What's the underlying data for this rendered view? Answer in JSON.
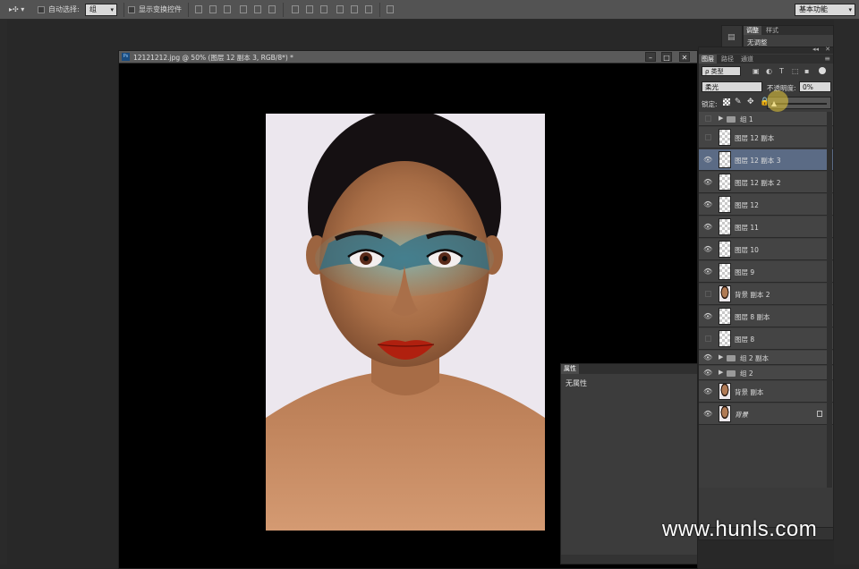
{
  "options_bar": {
    "auto_select_label": "自动选择:",
    "auto_select_value": "组",
    "transform_controls_label": "显示变换控件",
    "workspace": "基本功能"
  },
  "document": {
    "title": "12121212.jpg @ 50% (图层 12 副本 3, RGB/8*) *",
    "ps_badge": "Ps"
  },
  "adjustments_panel": {
    "tabs": [
      "调整",
      "样式"
    ],
    "content": "无调整"
  },
  "layers_panel": {
    "tabs": [
      "图层",
      "路径",
      "通道"
    ],
    "filter_kind": "ρ 类型",
    "blend_mode": "柔光",
    "opacity_label": "不透明度:",
    "opacity_value": "0%",
    "lock_label": "锁定:",
    "fill_label": "填充:",
    "layers": [
      {
        "name": "组 1",
        "type": "group",
        "visible": false
      },
      {
        "name": "图层 12 副本",
        "type": "layer",
        "visible": false
      },
      {
        "name": "图层 12 副本 3",
        "type": "layer",
        "visible": true,
        "selected": true
      },
      {
        "name": "图层 12 副本 2",
        "type": "layer",
        "visible": true
      },
      {
        "name": "图层 12",
        "type": "layer",
        "visible": true
      },
      {
        "name": "图层 11",
        "type": "layer",
        "visible": true
      },
      {
        "name": "图层 10",
        "type": "layer",
        "visible": true
      },
      {
        "name": "图层 9",
        "type": "layer",
        "visible": true
      },
      {
        "name": "背景 副本 2",
        "type": "photo",
        "visible": false
      },
      {
        "name": "图层 8 副本",
        "type": "layer",
        "visible": true
      },
      {
        "name": "图层 8",
        "type": "layer",
        "visible": false
      },
      {
        "name": "组 2 副本",
        "type": "group",
        "visible": true
      },
      {
        "name": "组 2",
        "type": "group",
        "visible": true
      },
      {
        "name": "背景 副本",
        "type": "photo",
        "visible": true
      },
      {
        "name": "背景",
        "type": "photo",
        "visible": true,
        "locked": true
      }
    ]
  },
  "properties_panel": {
    "tab": "属性",
    "content": "无属性"
  },
  "watermark": "www.hunls.com"
}
